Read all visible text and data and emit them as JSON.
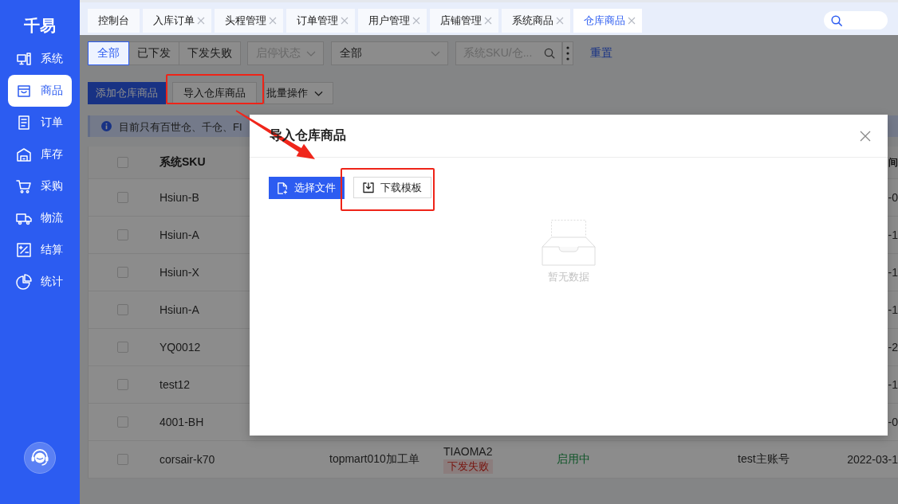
{
  "sidebar": {
    "logo": "千易",
    "items": [
      {
        "label": "系统",
        "selected": false
      },
      {
        "label": "商品",
        "selected": true
      },
      {
        "label": "订单",
        "selected": false
      },
      {
        "label": "库存",
        "selected": false
      },
      {
        "label": "采购",
        "selected": false
      },
      {
        "label": "物流",
        "selected": false
      },
      {
        "label": "结算",
        "selected": false
      },
      {
        "label": "统计",
        "selected": false
      }
    ]
  },
  "tabs": [
    {
      "label": "控制台",
      "closable": false,
      "selected": false
    },
    {
      "label": "入库订单",
      "closable": true,
      "selected": false
    },
    {
      "label": "头程管理",
      "closable": true,
      "selected": false
    },
    {
      "label": "订单管理",
      "closable": true,
      "selected": false
    },
    {
      "label": "用户管理",
      "closable": true,
      "selected": false
    },
    {
      "label": "店铺管理",
      "closable": true,
      "selected": false
    },
    {
      "label": "系统商品",
      "closable": true,
      "selected": false
    },
    {
      "label": "仓库商品",
      "closable": true,
      "selected": true
    }
  ],
  "filters": {
    "status": [
      {
        "label": "全部",
        "selected": true
      },
      {
        "label": "已下发",
        "selected": false
      },
      {
        "label": "下发失败",
        "selected": false
      }
    ],
    "enable_select": {
      "placeholder": "启停状态"
    },
    "type_select": {
      "value": "全部"
    },
    "search": {
      "placeholder": "系统SKU/仓..."
    },
    "reset": "重置"
  },
  "actions": [
    {
      "label": "添加仓库商品",
      "kind": "primary"
    },
    {
      "label": "导入仓库商品",
      "kind": "default"
    },
    {
      "label": "批量操作",
      "kind": "dropdown"
    }
  ],
  "alert": {
    "text": "目前只有百世仓、千仓、FI"
  },
  "table": {
    "header": {
      "checked": false,
      "sku": "系统SKU",
      "column_6": "间"
    },
    "rows": [
      {
        "checked": false,
        "sku": "Hsiun-B",
        "column_6": "-0"
      },
      {
        "checked": false,
        "sku": "Hsiun-A",
        "column_6": "-1"
      },
      {
        "checked": false,
        "sku": "Hsiun-X",
        "column_6": "-1"
      },
      {
        "checked": false,
        "sku": "Hsiun-A",
        "column_6": "-1"
      },
      {
        "checked": false,
        "sku": "YQ0012",
        "column_6": "-2"
      },
      {
        "checked": false,
        "sku": "test12",
        "column_6": "-1"
      },
      {
        "checked": false,
        "sku": "4001-BH",
        "column_6": "-0"
      },
      {
        "checked": false,
        "sku": "corsair-k70",
        "column_2": "topmart010加工单",
        "column_3": {
          "text": "TIAOMA2",
          "tag": "下发失败"
        },
        "column_4": "启用中",
        "column_5": "test主账号",
        "column_6": "2022-03-1"
      }
    ]
  },
  "modal": {
    "title": "导入仓库商品",
    "buttons": [
      {
        "label": "选择文件",
        "kind": "upload"
      },
      {
        "label": "下载模板",
        "kind": "download"
      }
    ],
    "empty_text": "暂无数据"
  }
}
